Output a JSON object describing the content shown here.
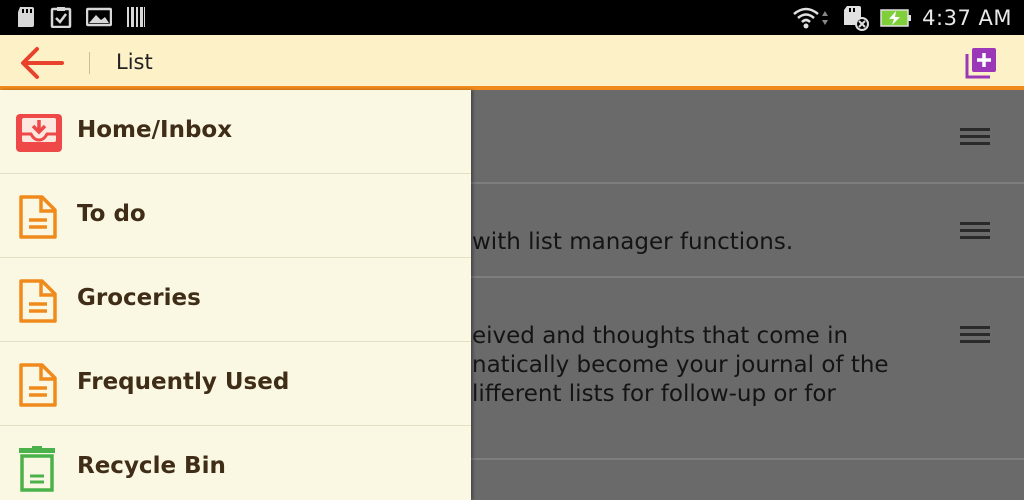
{
  "status_bar": {
    "icons": [
      "sd-card-icon",
      "clipboard-icon",
      "image-icon",
      "barcode-icon",
      "wifi-icon",
      "sd-card-error-icon",
      "battery-charging-icon"
    ],
    "time": "4:37 AM"
  },
  "action_bar": {
    "title": "List",
    "back_icon": "arrow-left-icon",
    "add_icon": "add-box-icon",
    "accent_color": "#f08a1c",
    "back_color": "#e8412c",
    "add_color": "#9a38b8"
  },
  "background_list": {
    "rows": [
      {
        "lines": []
      },
      {
        "lines": [
          "with list manager functions."
        ]
      },
      {
        "lines": [
          "eived and thoughts that come in",
          "natically become your journal of the",
          "lifferent lists for follow-up or for"
        ]
      }
    ]
  },
  "drawer": {
    "items": [
      {
        "label": "Home/Inbox",
        "icon": "inbox-icon"
      },
      {
        "label": "To do",
        "icon": "document-icon"
      },
      {
        "label": "Groceries",
        "icon": "document-icon"
      },
      {
        "label": "Frequently Used",
        "icon": "document-icon"
      },
      {
        "label": "Recycle Bin",
        "icon": "trash-icon"
      }
    ]
  }
}
